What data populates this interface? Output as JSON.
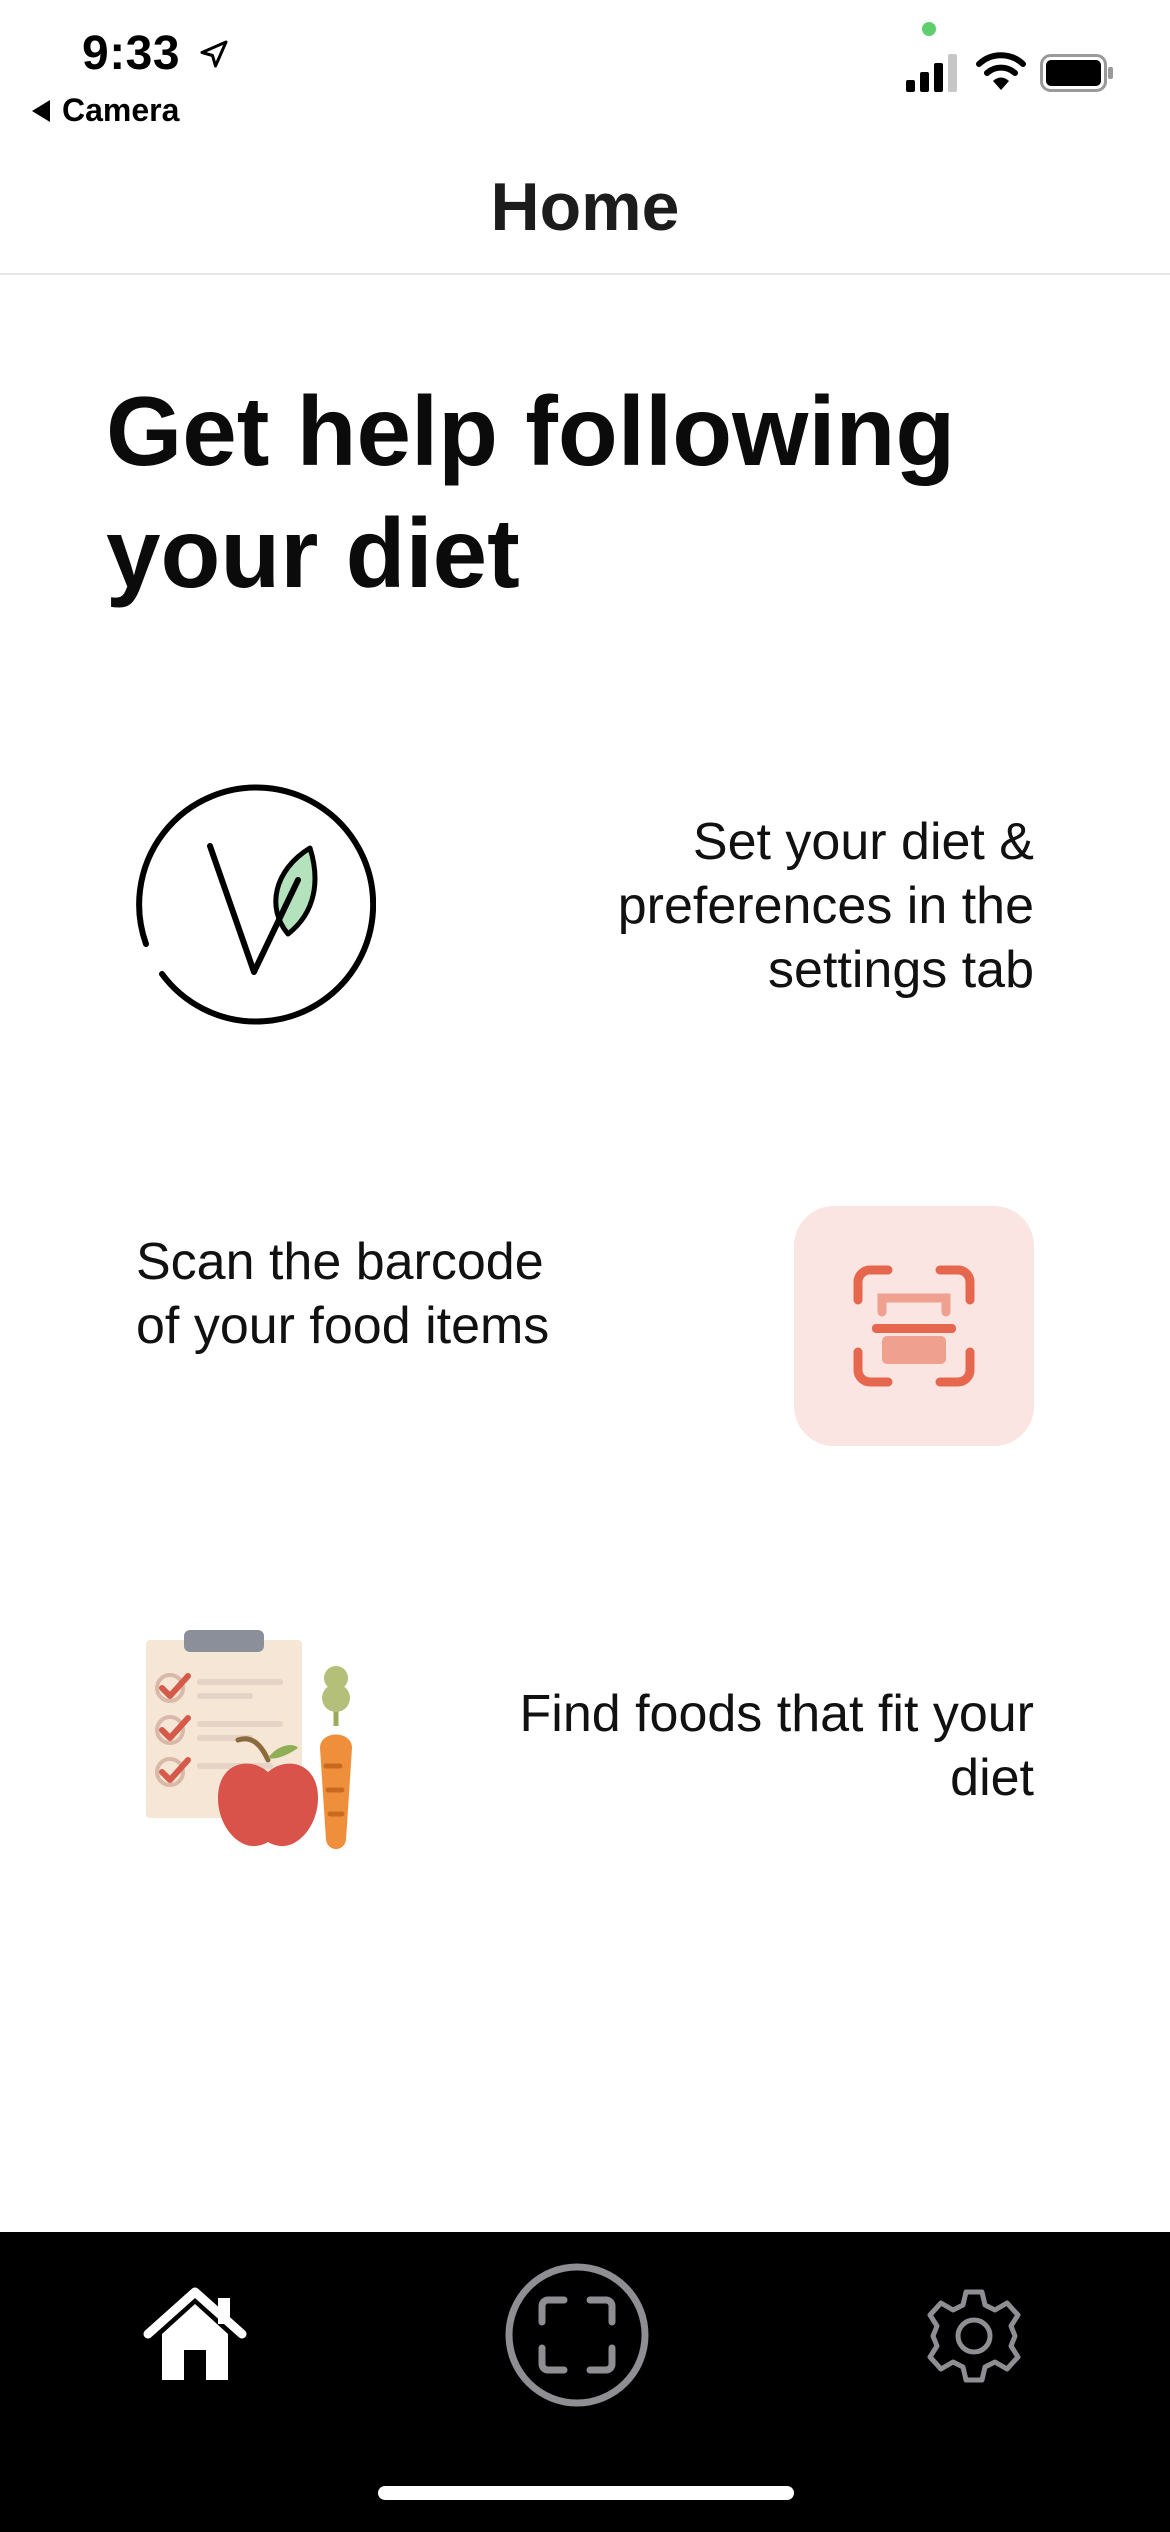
{
  "status_bar": {
    "time": "9:33",
    "back_app_label": "Camera",
    "location_icon": "location-arrow-icon",
    "signal_icon": "cellular-signal-icon",
    "wifi_icon": "wifi-icon",
    "battery_icon": "battery-icon"
  },
  "nav": {
    "title": "Home"
  },
  "main": {
    "headline": "Get help following your diet",
    "features": [
      {
        "text": "Set your diet & preferences in the settings tab",
        "icon": "vegan-leaf-icon"
      },
      {
        "text": "Scan the barcode of your food items",
        "icon": "barcode-scan-icon"
      },
      {
        "text": "Find foods that fit your diet",
        "icon": "food-checklist-icon"
      }
    ]
  },
  "tab_bar": {
    "items": [
      {
        "id": "home",
        "icon": "home-icon",
        "selected": true
      },
      {
        "id": "scan",
        "icon": "scan-icon",
        "selected": false
      },
      {
        "id": "settings",
        "icon": "gear-icon",
        "selected": false
      }
    ]
  },
  "colors": {
    "scan_accent": "#e5674d",
    "scan_tile_bg": "#fae5e3",
    "leaf_green": "#b4e2bd",
    "tab_bar_bg": "#000000",
    "tab_inactive": "#8e8e93"
  }
}
